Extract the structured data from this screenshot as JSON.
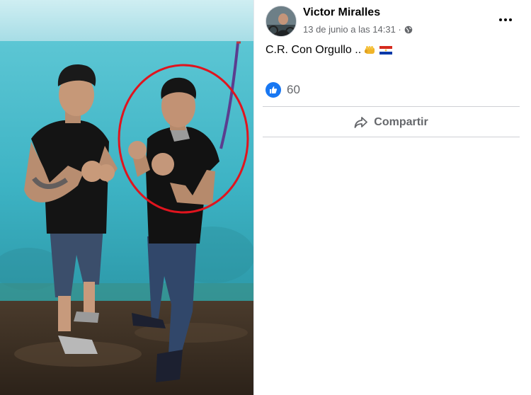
{
  "post": {
    "author": "Victor Miralles",
    "timestamp": "13 de junio a las 14:31 ·",
    "privacy_icon": "globe-icon",
    "caption": "C.R. Con Orgullo ..",
    "caption_emojis": [
      "fist-icon",
      "paraguay-flag-icon"
    ],
    "reactions": {
      "icon": "like-icon",
      "count": "60"
    },
    "share_label": "Compartir",
    "share_icon": "share-arrow-icon",
    "more_icon": "more-options-icon"
  },
  "colors": {
    "like_blue": "#1877f2",
    "annotation_red": "#e0141e",
    "secondary_text": "#65676b",
    "wall_cyan": "#3fb8c8"
  }
}
